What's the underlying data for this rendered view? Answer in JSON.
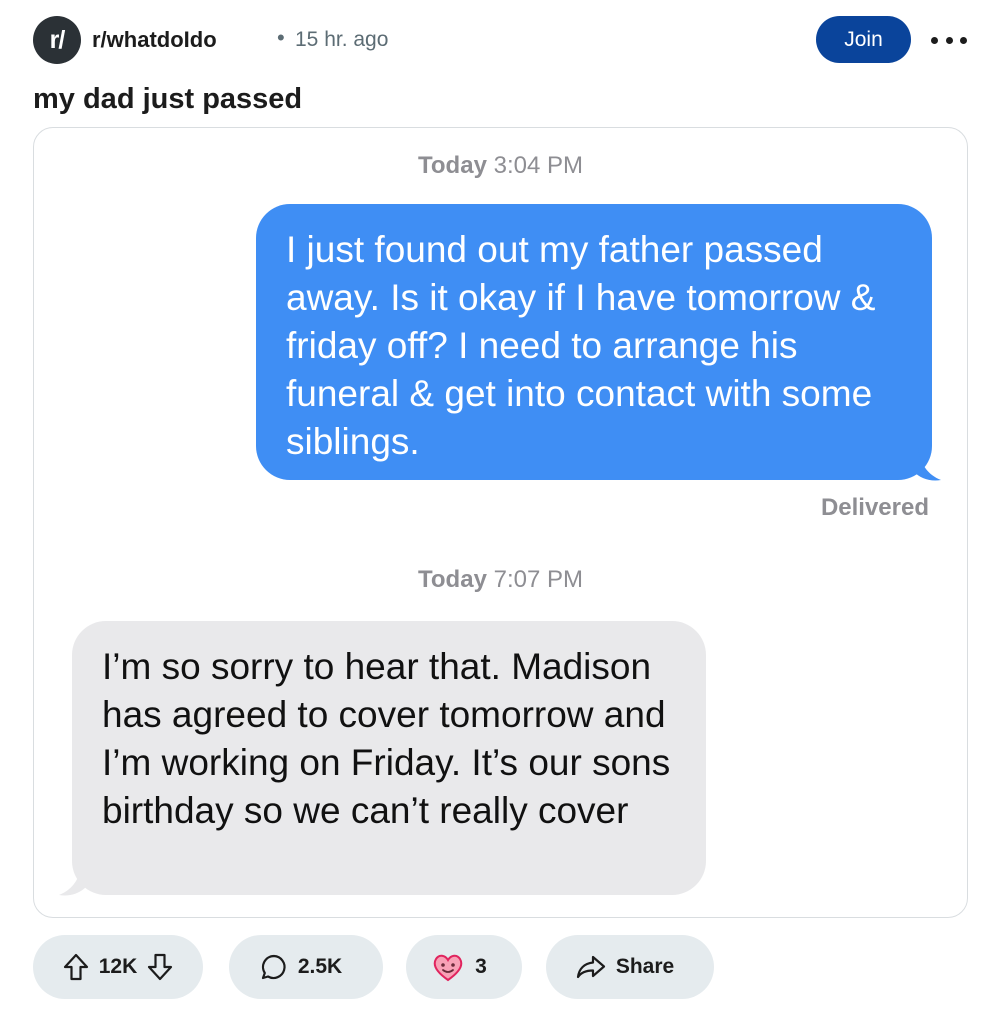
{
  "post": {
    "subreddit_icon": "r/",
    "subreddit": "r/whatdoIdo",
    "separator": "•",
    "time_ago": "15 hr. ago",
    "join_label": "Join",
    "title": "my dad just passed"
  },
  "chat": {
    "timestamp_1_day": "Today",
    "timestamp_1_time": "3:04 PM",
    "sent_message": "I just found out my father passed away. Is it okay if I have tomorrow & friday off? I need to arrange his funeral & get into contact with some siblings.",
    "delivered_label": "Delivered",
    "timestamp_2_day": "Today",
    "timestamp_2_time": "7:07 PM",
    "received_message": "I’m so sorry to hear that. Madison has agreed to cover tomorrow and I’m working on Friday. It’s our sons birthday so we can’t really cover"
  },
  "actions": {
    "vote_count": "12K",
    "comment_count": "2.5K",
    "award_count": "3",
    "share_label": "Share"
  },
  "colors": {
    "join_bg": "#0a449b",
    "sent_bubble": "#3f8ef4",
    "received_bubble": "#e9e9eb",
    "pill_bg": "#e5ebee"
  },
  "icons": [
    "more-options-icon",
    "upvote-icon",
    "downvote-icon",
    "comment-icon",
    "award-icon",
    "share-icon"
  ]
}
